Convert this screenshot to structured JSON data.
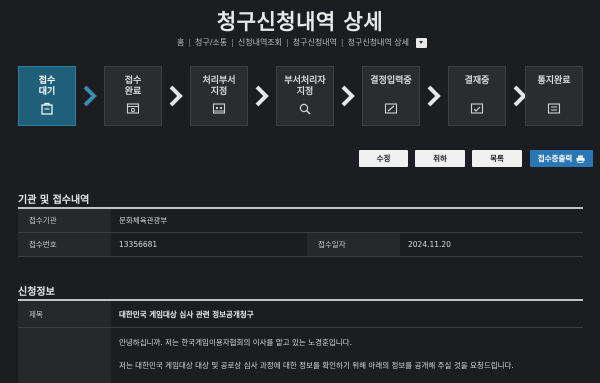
{
  "page": {
    "title": "청구신청내역 상세"
  },
  "breadcrumb": {
    "items": [
      "홈",
      "청구/소통",
      "신청내역조회",
      "청구신청내역",
      "청구신청내역 상세"
    ],
    "separator": "|"
  },
  "steps": [
    {
      "line1": "접수",
      "line2": "대기",
      "icon": "document-clip-icon",
      "active": true
    },
    {
      "line1": "접수",
      "line2": "완료",
      "icon": "monitor-window-icon",
      "active": false
    },
    {
      "line1": "처리부서",
      "line2": "지정",
      "icon": "building-icon",
      "active": false
    },
    {
      "line1": "부서처리자",
      "line2": "지정",
      "icon": "search-person-icon",
      "active": false
    },
    {
      "line1": "결정입력중",
      "line2": "",
      "icon": "edit-window-icon",
      "active": false
    },
    {
      "line1": "결재중",
      "line2": "",
      "icon": "approval-window-icon",
      "active": false
    },
    {
      "line1": "통지완료",
      "line2": "",
      "icon": "list-window-icon",
      "active": false
    }
  ],
  "colors": {
    "active_step": "#1f5f7a",
    "primary_button": "#2b77b6",
    "background": "#1b1d20"
  },
  "actions": {
    "edit": "수정",
    "cancel": "취하",
    "list": "목록",
    "print_receipt": "접수증출력"
  },
  "reception": {
    "section_title": "기관 및 접수내역",
    "agency_label": "접수기관",
    "agency_value": "문화체육관광부",
    "number_label": "접수번호",
    "number_value": "13356681",
    "date_label": "접수일자",
    "date_value": "2024.11.20"
  },
  "application": {
    "section_title": "신청정보",
    "subject_label": "제목",
    "subject_value": "대한민국 게임대상 심사 관련 정보공개청구",
    "content_lines": [
      "안녕하십니까. 저는 한국게임이용자협회의 이사를 맡고 있는 노경훈입니다.",
      "저는 대한민국 게임대상 대상 및 공로상 심사 과정에 대한 정보를 확인하기 위해 아래의 정보를 공개해 주실 것을 요청드립니다."
    ]
  }
}
